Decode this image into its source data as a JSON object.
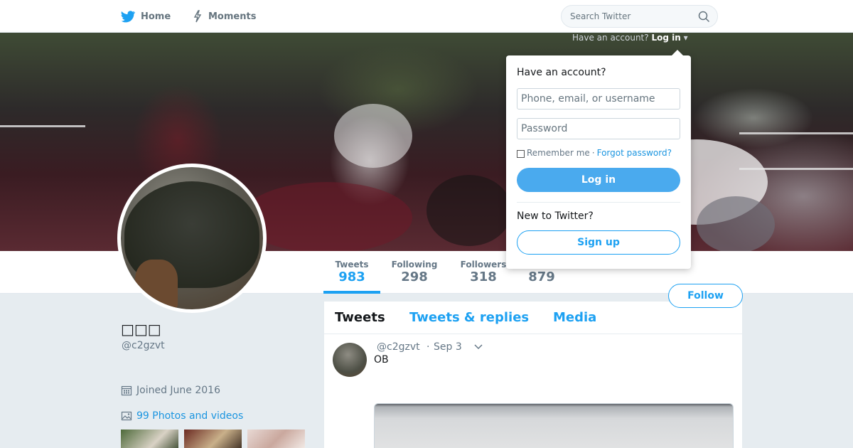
{
  "nav": {
    "home_label": "Home",
    "moments_label": "Moments",
    "search_placeholder": "Search Twitter"
  },
  "header_login": {
    "prompt": "Have an account?",
    "login_label": "Log in",
    "caret": "▾"
  },
  "stats": [
    {
      "label": "Tweets",
      "value": "983",
      "active": true
    },
    {
      "label": "Following",
      "value": "298",
      "active": false
    },
    {
      "label": "Followers",
      "value": "318",
      "active": false
    },
    {
      "label": "",
      "value": "879",
      "active": false
    }
  ],
  "follow_label": "Follow",
  "profile": {
    "name": "□□□",
    "handle": "@c2gzvt",
    "joined": "Joined June 2016",
    "photos_link": "99 Photos and videos"
  },
  "timeline": {
    "tabs": [
      "Tweets",
      "Tweets & replies",
      "Media"
    ],
    "tweet": {
      "handle": "@c2gzvt",
      "separator": "·",
      "date": "Sep 3",
      "text": "OB"
    }
  },
  "login_dropdown": {
    "title": "Have an account?",
    "username_placeholder": "Phone, email, or username",
    "password_placeholder": "Password",
    "remember_label": "Remember me",
    "separator": "·",
    "forgot_label": "Forgot password?",
    "login_button": "Log in",
    "new_prompt": "New to Twitter?",
    "signup_button": "Sign up"
  },
  "colors": {
    "accent": "#1da1f2",
    "link": "#1b95e0",
    "background": "#e6ecf0"
  }
}
